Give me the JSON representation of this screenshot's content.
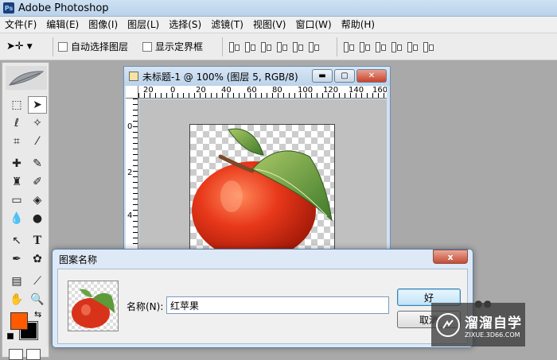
{
  "app": {
    "title": "Adobe Photoshop",
    "logo": "Ps"
  },
  "menu": [
    "文件(F)",
    "编辑(E)",
    "图像(I)",
    "图层(L)",
    "选择(S)",
    "滤镜(T)",
    "视图(V)",
    "窗口(W)",
    "帮助(H)"
  ],
  "options": {
    "tool_icon": "move-tool-icon",
    "auto_select_label": "自动选择图层",
    "show_bounds_label": "显示定界框"
  },
  "document": {
    "title": "未标题-1 @ 100% (图层 5, RGB/8)",
    "ruler_top": [
      "20",
      "0",
      "20",
      "40",
      "60",
      "80",
      "100",
      "120",
      "140",
      "160"
    ],
    "ruler_left": [
      "0",
      "2",
      "4"
    ]
  },
  "toolbox": {
    "tools": [
      "marquee",
      "move",
      "lasso",
      "magic-wand",
      "crop",
      "slice",
      "healing",
      "brush",
      "clone-stamp",
      "history-brush",
      "eraser",
      "paint-bucket",
      "blur",
      "dodge",
      "path-select",
      "type",
      "pen",
      "custom-shape",
      "notes",
      "eyedropper",
      "hand",
      "zoom"
    ],
    "foreground_color": "#ff5a00",
    "background_color": "#000000"
  },
  "dialog": {
    "title": "图案名称",
    "close_label": "x",
    "name_label": "名称(N):",
    "name_value": "红苹果",
    "ok_label": "好",
    "cancel_label": "取消"
  },
  "watermark": {
    "name": "溜溜自学",
    "url": "ZIXUE.3D66.COM"
  }
}
